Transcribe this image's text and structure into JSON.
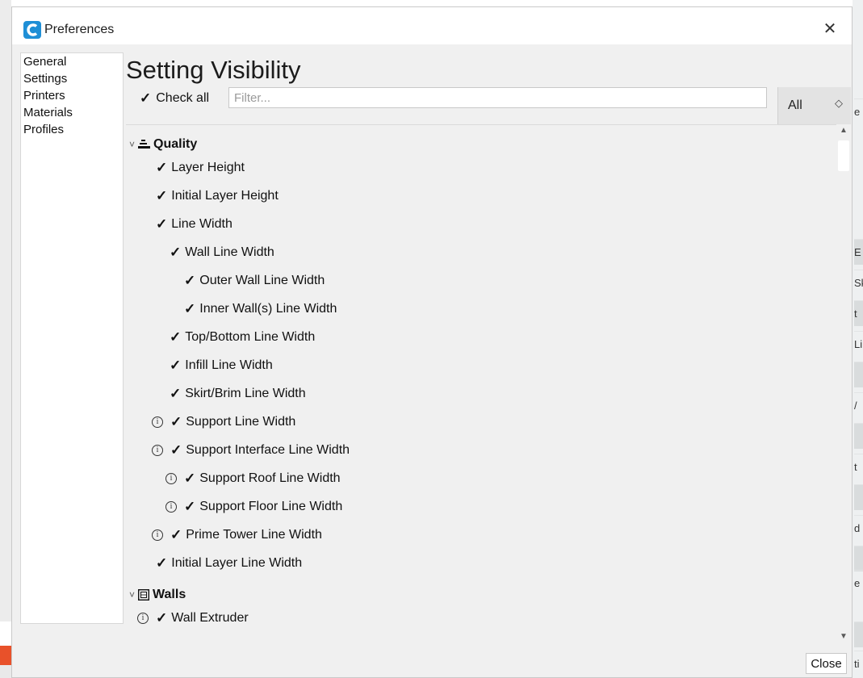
{
  "window": {
    "title": "Preferences",
    "close_glyph": "✕"
  },
  "nav": {
    "items": [
      "General",
      "Settings",
      "Printers",
      "Materials",
      "Profiles"
    ]
  },
  "main": {
    "heading": "Setting Visibility",
    "check_all_label": "Check all",
    "filter_placeholder": "Filter...",
    "filter_value": "",
    "visibility_select": "All"
  },
  "settings": {
    "categories": {
      "quality": "Quality",
      "walls": "Walls"
    },
    "items": {
      "layer_height": "Layer Height",
      "initial_layer_height": "Initial Layer Height",
      "line_width": "Line Width",
      "wall_line_width": "Wall Line Width",
      "outer_wall_line_width": "Outer Wall Line Width",
      "inner_walls_line_width": "Inner Wall(s) Line Width",
      "top_bottom_line_width": "Top/Bottom Line Width",
      "infill_line_width": "Infill Line Width",
      "skirt_brim_line_width": "Skirt/Brim Line Width",
      "support_line_width": "Support Line Width",
      "support_interface_line_width": "Support Interface Line Width",
      "support_roof_line_width": "Support Roof Line Width",
      "support_floor_line_width": "Support Floor Line Width",
      "prime_tower_line_width": "Prime Tower Line Width",
      "initial_layer_line_width": "Initial Layer Line Width",
      "wall_extruder": "Wall Extruder"
    }
  },
  "footer": {
    "close_label": "Close"
  },
  "background": {
    "right_fragments": [
      "e",
      "E",
      "Sk",
      "t",
      "Li",
      "",
      "/",
      "",
      "t",
      "",
      "d",
      "",
      "e",
      "",
      "ti"
    ]
  },
  "icons": {
    "checkmark": "✓",
    "info": "i",
    "chevron": "˅"
  },
  "colors": {
    "accent_orange": "#e8512a",
    "logo_blue": "#1f8fd6"
  }
}
